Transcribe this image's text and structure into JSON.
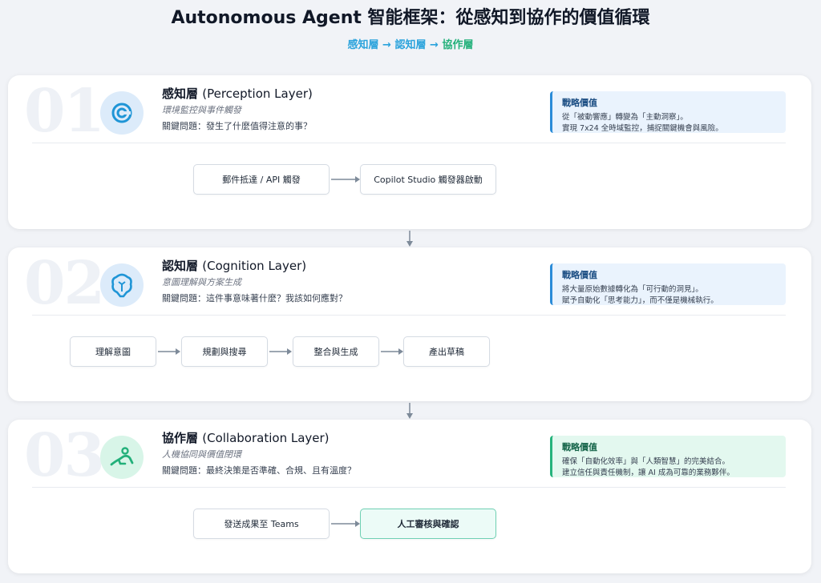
{
  "title": "Autonomous Agent 智能框架：從感知到協作的價值循環",
  "subtitle": {
    "step1": "感知層",
    "step2": "認知層",
    "step3": "協作層",
    "arrow": "→"
  },
  "colors": {
    "blue": "#2ba3dc",
    "green": "#22b07a",
    "value_blue": "#eaf3fd",
    "value_green": "#e3f8ef"
  },
  "layers": [
    {
      "number": "01",
      "icon": "radar-icon",
      "title_zh": "感知層",
      "title_en": "(Perception Layer)",
      "subtitle": "環境監控與事件觸發",
      "question": "關鍵問題：發生了什麼值得注意的事？",
      "value_title": "戰略價值",
      "value_lines": [
        "從「被動響應」轉變為「主動洞察」。",
        "實現 7x24 全時域監控，捕捉關鍵機會與風險。"
      ],
      "steps": [
        "郵件抵達 / API 觸發",
        "Copilot Studio 觸發器啟動"
      ]
    },
    {
      "number": "02",
      "icon": "brain-icon",
      "title_zh": "認知層",
      "title_en": "(Cognition Layer)",
      "subtitle": "意圖理解與方案生成",
      "question": "關鍵問題：這件事意味著什麼？我該如何應對？",
      "value_title": "戰略價值",
      "value_lines": [
        "將大量原始數據轉化為「可行動的洞見」。",
        "賦予自動化「思考能力」，而不僅是機械執行。"
      ],
      "steps": [
        "理解意圖",
        "規劃與搜尋",
        "整合與生成",
        "產出草稿"
      ]
    },
    {
      "number": "03",
      "icon": "handshake-icon",
      "title_zh": "協作層",
      "title_en": "(Collaboration Layer)",
      "subtitle": "人機協同與價值閉環",
      "question": "關鍵問題：最終決策是否準確、合規、且有溫度？",
      "value_title": "戰略價值",
      "value_lines": [
        "確保「自動化效率」與「人類智慧」的完美結合。",
        "建立信任與責任機制，讓 AI 成為可靠的業務夥伴。"
      ],
      "steps": [
        "發送成果至 Teams",
        "人工審核與確認"
      ]
    }
  ]
}
